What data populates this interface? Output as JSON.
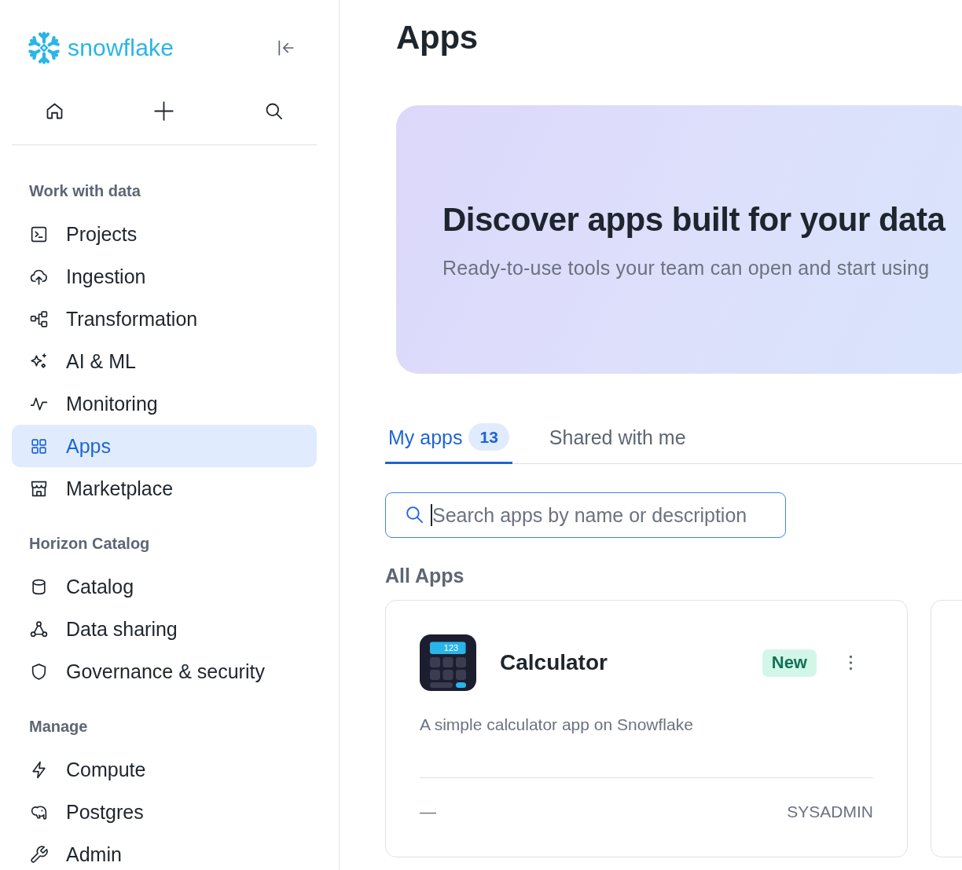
{
  "sidebar": {
    "logo": "snowflake",
    "sections": [
      {
        "heading": "Work with data",
        "items": [
          {
            "label": "Projects",
            "selected": false
          },
          {
            "label": "Ingestion",
            "selected": false
          },
          {
            "label": "Transformation",
            "selected": false
          },
          {
            "label": "AI & ML",
            "selected": false
          },
          {
            "label": "Monitoring",
            "selected": false
          },
          {
            "label": "Apps",
            "selected": true
          },
          {
            "label": "Marketplace",
            "selected": false
          }
        ]
      },
      {
        "heading": "Horizon Catalog",
        "items": [
          {
            "label": "Catalog",
            "selected": false
          },
          {
            "label": "Data sharing",
            "selected": false
          },
          {
            "label": "Governance & security",
            "selected": false
          }
        ]
      },
      {
        "heading": "Manage",
        "items": [
          {
            "label": "Compute",
            "selected": false
          },
          {
            "label": "Postgres",
            "selected": false
          },
          {
            "label": "Admin",
            "selected": false
          }
        ]
      }
    ]
  },
  "main": {
    "title": "Apps",
    "banner": {
      "heading": "Discover apps built for your data",
      "subtitle": "Ready-to-use tools your team can open and start using"
    },
    "tabs": [
      {
        "label": "My apps",
        "count": "13",
        "selected": true
      },
      {
        "label": "Shared with me",
        "selected": false
      }
    ],
    "search": {
      "placeholder": "Search apps by name or description",
      "focused": true
    },
    "section_title": "All Apps",
    "apps": [
      {
        "icon_text": "123",
        "name": "Calculator",
        "badge": "New",
        "description": "A simple calculator app on Snowflake",
        "footer_left": "—",
        "footer_right": "SYSADMIN"
      }
    ]
  }
}
